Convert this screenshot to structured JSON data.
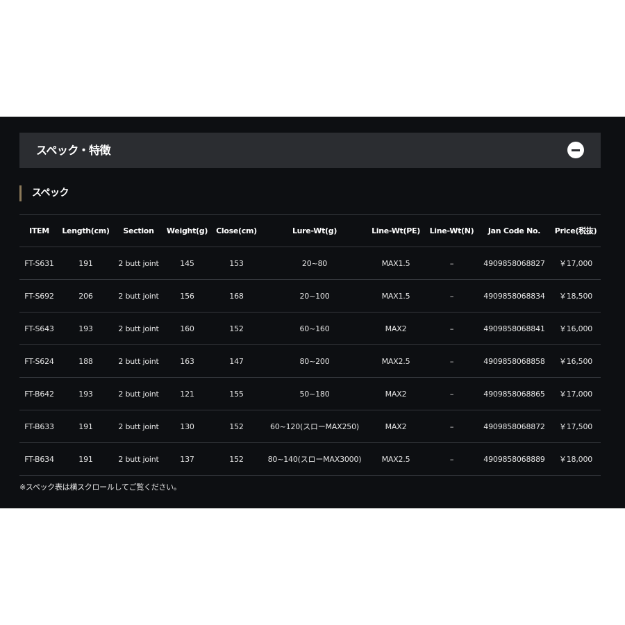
{
  "accordion": {
    "title": "スペック・特徴",
    "toggle_icon": "minus-circle-icon"
  },
  "section": {
    "title": "スペック"
  },
  "spec_table": {
    "headers": [
      "ITEM",
      "Length(cm)",
      "Section",
      "Weight(g)",
      "Close(cm)",
      "Lure-Wt(g)",
      "Line-Wt(PE)",
      "Line-Wt(N)",
      "Jan Code No.",
      "Price(税抜)"
    ],
    "rows": [
      [
        "FT-S631",
        "191",
        "2 butt joint",
        "145",
        "153",
        "20~80",
        "MAX1.5",
        "–",
        "4909858068827",
        "￥17,000"
      ],
      [
        "FT-S692",
        "206",
        "2 butt joint",
        "156",
        "168",
        "20~100",
        "MAX1.5",
        "–",
        "4909858068834",
        "￥18,500"
      ],
      [
        "FT-S643",
        "193",
        "2 butt joint",
        "160",
        "152",
        "60~160",
        "MAX2",
        "–",
        "4909858068841",
        "￥16,000"
      ],
      [
        "FT-S624",
        "188",
        "2 butt joint",
        "163",
        "147",
        "80~200",
        "MAX2.5",
        "–",
        "4909858068858",
        "￥16,500"
      ],
      [
        "FT-B642",
        "193",
        "2 butt joint",
        "121",
        "155",
        "50~180",
        "MAX2",
        "–",
        "4909858068865",
        "￥17,000"
      ],
      [
        "FT-B633",
        "191",
        "2 butt joint",
        "130",
        "152",
        "60~120(スローMAX250)",
        "MAX2",
        "–",
        "4909858068872",
        "￥17,500"
      ],
      [
        "FT-B634",
        "191",
        "2 butt joint",
        "137",
        "152",
        "80~140(スローMAX3000)",
        "MAX2.5",
        "–",
        "4909858068889",
        "￥18,000"
      ]
    ]
  },
  "note": "※スペック表は横スクロールしてご覧ください。",
  "colors": {
    "panel_bg": "#0d0f12",
    "header_bg": "#2b2d31",
    "accent": "#8c7a5a",
    "divider": "#34373c"
  }
}
